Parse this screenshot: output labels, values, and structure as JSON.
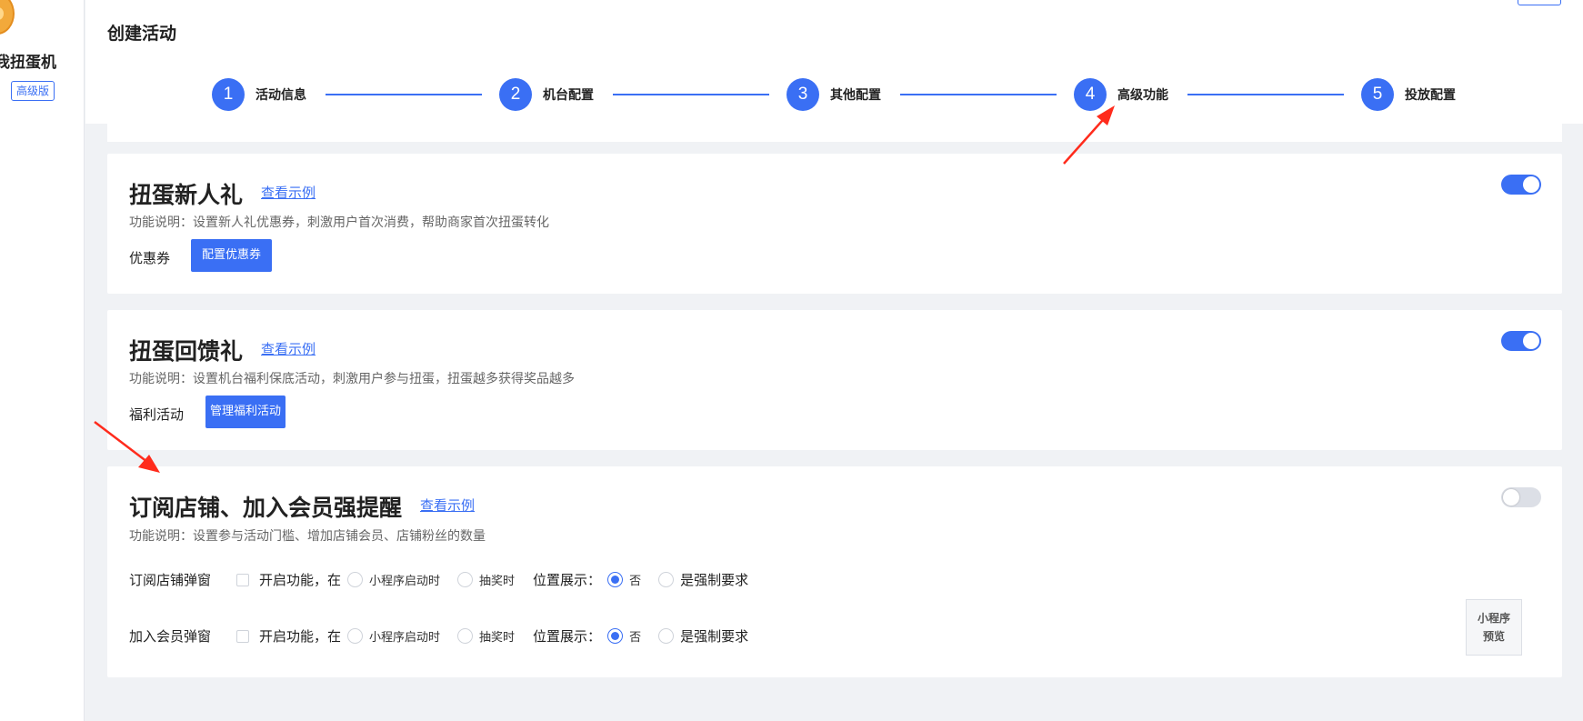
{
  "sidebar": {
    "shop_name": "我扭蛋机",
    "badge": "高级版"
  },
  "header": {
    "title": "创建活动"
  },
  "steps": [
    {
      "number": "1",
      "label": "活动信息"
    },
    {
      "number": "2",
      "label": "机台配置"
    },
    {
      "number": "3",
      "label": "其他配置"
    },
    {
      "number": "4",
      "label": "高级功能"
    },
    {
      "number": "5",
      "label": "投放配置"
    }
  ],
  "cards": {
    "newcomer": {
      "title": "扭蛋新人礼",
      "example_link": "查看示例",
      "desc": "功能说明：设置新人礼优惠券，刺激用户首次消费，帮助商家首次扭蛋转化",
      "row_label": "优惠券",
      "button": "配置优惠券",
      "toggle_on": true
    },
    "feedback": {
      "title": "扭蛋回馈礼",
      "example_link": "查看示例",
      "desc": "功能说明：设置机台福利保底活动，刺激用户参与扭蛋，扭蛋越多获得奖品越多",
      "row_label": "福利活动",
      "button": "管理福利活动",
      "toggle_on": true
    },
    "subscribe": {
      "title": "订阅店铺、加入会员强提醒",
      "example_link": "查看示例",
      "desc": "功能说明：设置参与活动门槛、增加店铺会员、店铺粉丝的数量",
      "toggle_on": false,
      "rows": [
        {
          "name": "订阅店铺弹窗",
          "enable_text": "开启功能，在",
          "timing_options": [
            "小程序启动时",
            "抽奖时"
          ],
          "position_label": "位置展示：",
          "force_options": [
            "否",
            "是强制要求"
          ],
          "force_selected": "否"
        },
        {
          "name": "加入会员弹窗",
          "enable_text": "开启功能，在",
          "timing_options": [
            "小程序启动时",
            "抽奖时"
          ],
          "position_label": "位置展示：",
          "force_options": [
            "否",
            "是强制要求"
          ],
          "force_selected": "否"
        }
      ],
      "preview": {
        "line1": "小程序",
        "line2": "预览"
      }
    }
  },
  "colors": {
    "primary": "#3a6ff4",
    "annotation_arrow": "#ff2b1c"
  }
}
